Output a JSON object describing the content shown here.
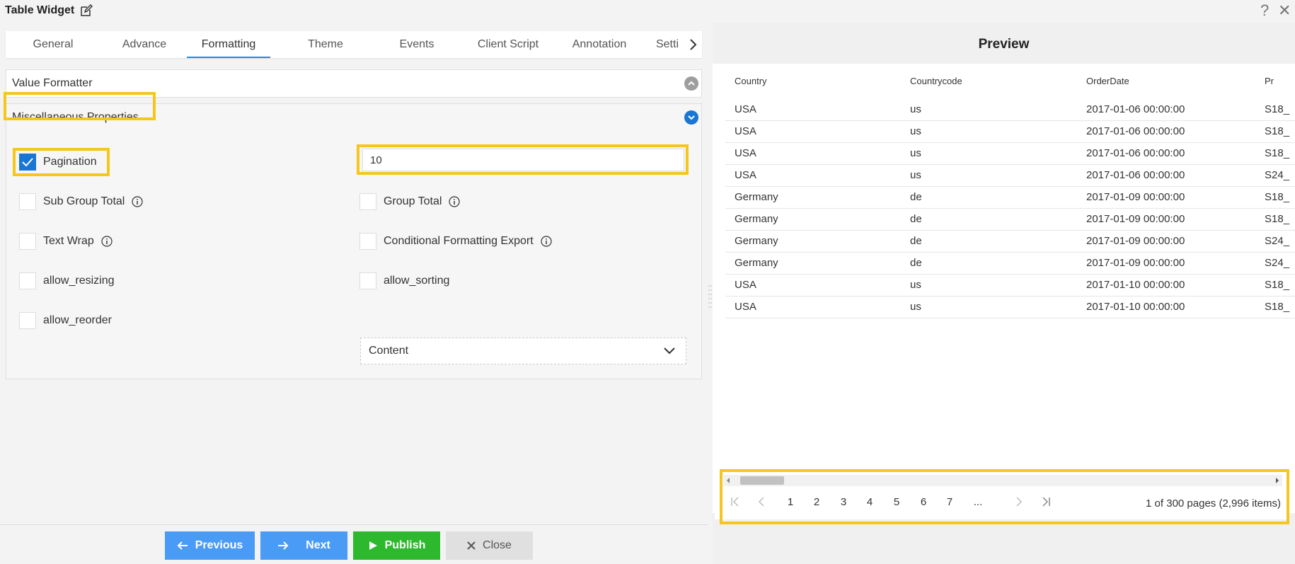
{
  "window": {
    "title": "Table Widget",
    "help": "?",
    "close": "✕"
  },
  "tabs": [
    {
      "label": "General"
    },
    {
      "label": "Advance"
    },
    {
      "label": "Formatting"
    },
    {
      "label": "Theme"
    },
    {
      "label": "Events"
    },
    {
      "label": "Client Script"
    },
    {
      "label": "Annotation"
    },
    {
      "label": "Setti"
    }
  ],
  "sections": {
    "value_formatter": "Value Formatter",
    "misc": "Miscellaneous Properties"
  },
  "misc": {
    "pagination_label": "Pagination",
    "pagination_value": "10",
    "sub_group_total": "Sub Group Total",
    "group_total": "Group Total",
    "text_wrap": "Text Wrap",
    "conditional_formatting_export": "Conditional Formatting Export",
    "allow_resizing": "allow_resizing",
    "allow_sorting": "allow_sorting",
    "allow_reorder": "allow_reorder",
    "select_value": "Content"
  },
  "buttons": {
    "previous": "Previous",
    "next": "Next",
    "publish": "Publish",
    "close": "Close"
  },
  "preview": {
    "title": "Preview",
    "columns": [
      "Country",
      "Countrycode",
      "OrderDate",
      "Pr"
    ],
    "rows": [
      [
        "USA",
        "us",
        "2017-01-06 00:00:00",
        "S18_"
      ],
      [
        "USA",
        "us",
        "2017-01-06 00:00:00",
        "S18_"
      ],
      [
        "USA",
        "us",
        "2017-01-06 00:00:00",
        "S18_"
      ],
      [
        "USA",
        "us",
        "2017-01-06 00:00:00",
        "S24_"
      ],
      [
        "Germany",
        "de",
        "2017-01-09 00:00:00",
        "S18_"
      ],
      [
        "Germany",
        "de",
        "2017-01-09 00:00:00",
        "S18_"
      ],
      [
        "Germany",
        "de",
        "2017-01-09 00:00:00",
        "S24_"
      ],
      [
        "Germany",
        "de",
        "2017-01-09 00:00:00",
        "S24_"
      ],
      [
        "USA",
        "us",
        "2017-01-10 00:00:00",
        "S18_"
      ],
      [
        "USA",
        "us",
        "2017-01-10 00:00:00",
        "S18_"
      ]
    ],
    "pages": [
      "1",
      "2",
      "3",
      "4",
      "5",
      "6",
      "7",
      "..."
    ],
    "page_info": "1 of 300 pages (2,996 items)"
  },
  "colors": {
    "accent": "#1e88e5",
    "highlight": "#f6c61c",
    "primary_button": "#4a9bf5",
    "publish_button": "#2db82d"
  }
}
